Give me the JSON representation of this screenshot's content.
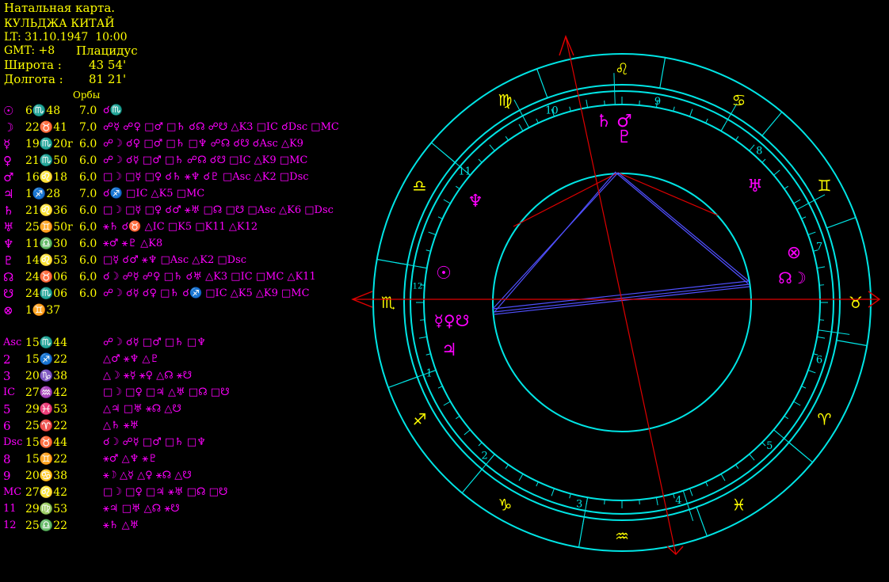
{
  "header": {
    "title": "Натальная карта.",
    "place": "КУЛЬДЖА КИТАЙ",
    "lt": "LT: 31.10.1947  10:00",
    "gmt": "GMT: +8",
    "house_system": "Плацидус",
    "lat_label": "Широта :",
    "lat_value": "43 54'",
    "lon_label": "Долгота :",
    "lon_value": "81 21'",
    "orbs_label": "Орбы"
  },
  "planets": [
    {
      "glyph": "☉",
      "pos": "6♏48",
      "orb": "7.0",
      "aspects": "☌♏"
    },
    {
      "glyph": "☽",
      "pos": "22♉41",
      "orb": "7.0",
      "aspects": "☍☿ ☍♀ □♂ □♄ ☌☊ ☍☋  △K3 □IC ☌Dsc □MC"
    },
    {
      "glyph": "☿",
      "pos": "19♏20r",
      "orb": "6.0",
      "aspects": "☍☽ ☌♀ □♂ □♄ □♆ ☍☊ ☌☋  ☌Asc △K9"
    },
    {
      "glyph": "♀",
      "pos": "21♏50",
      "orb": "6.0",
      "aspects": "☍☽ ☌☿ □♂ □♄ ☍☊ ☌☋  □IC △K9 □MC"
    },
    {
      "glyph": "♂",
      "pos": "16♌18",
      "orb": "6.0",
      "aspects": "□☽ □☿ □♀ ☌♄ ⚹♆ ☌♇  □Asc △K2 □Dsc"
    },
    {
      "glyph": "♃",
      "pos": "1♐28",
      "orb": "7.0",
      "aspects": "☌♐ □IC △K5 □MC"
    },
    {
      "glyph": "♄",
      "pos": "21♌36",
      "orb": "6.0",
      "aspects": "□☽ □☿ □♀ ☌♂ ⚹♅ □☊ □☋  □Asc △K6 □Dsc"
    },
    {
      "glyph": "♅",
      "pos": "25♊50r",
      "orb": "6.0",
      "aspects": "⚹♄ ☌♉ △IC □K5 □K11  △K12"
    },
    {
      "glyph": "♆",
      "pos": "11♎30",
      "orb": "6.0",
      "aspects": "⚹♂ ⚹♇ △K8"
    },
    {
      "glyph": "♇",
      "pos": "14♌53",
      "orb": "6.0",
      "aspects": "□☿ ☌♂ ⚹♆ □Asc △K2 □Dsc"
    },
    {
      "glyph": "☊",
      "pos": "24♉06",
      "orb": "6.0",
      "aspects": "☌☽ ☍☿ ☍♀ □♄ ☌♅  △K3 □IC □MC  △K11"
    },
    {
      "glyph": "☋",
      "pos": "24♏06",
      "orb": "6.0",
      "aspects": "☍☽ ☌☿ ☌♀ □♄ ☌♐  □IC △K5 △K9 □MC"
    },
    {
      "glyph": "⊗",
      "pos": "1♊37",
      "orb": "",
      "aspects": ""
    }
  ],
  "houses": [
    {
      "glyph": "Asc",
      "pos": "15♏44",
      "aspects": "☍☽ ☌☿ □♂ □♄ □♆"
    },
    {
      "glyph": "2",
      "pos": "15♐22",
      "aspects": "△♂ ⚹♆ △♇"
    },
    {
      "glyph": "3",
      "pos": "20♑38",
      "aspects": "△☽ ⚹☿ ⚹♀ △☊ ⚹☋"
    },
    {
      "glyph": "IC",
      "pos": "27♒42",
      "aspects": "□☽ □♀ □♃ △♅ □☊ □☋"
    },
    {
      "glyph": "5",
      "pos": "29♓53",
      "aspects": "△♃ □♅ ⚹☊ △☋"
    },
    {
      "glyph": "6",
      "pos": "25♈22",
      "aspects": "△♄ ⚹♅"
    },
    {
      "glyph": "Dsc",
      "pos": "15♉44",
      "aspects": "☌☽ ☍☿ □♂ □♄ □♆"
    },
    {
      "glyph": "8",
      "pos": "15♊22",
      "aspects": "⚹♂ △♆ ⚹♇"
    },
    {
      "glyph": "9",
      "pos": "20♋38",
      "aspects": "⚹☽ △☿ △♀ ⚹☊ △☋"
    },
    {
      "glyph": "MC",
      "pos": "27♌42",
      "aspects": "□☽ □♀ □♃ ⚹♅ □☊ □☋"
    },
    {
      "glyph": "11",
      "pos": "29♍53",
      "aspects": "⚹♃ □♅ △☊ ⚹☋"
    },
    {
      "glyph": "12",
      "pos": "25♎22",
      "aspects": "⚹♄ △♅"
    }
  ],
  "wheel": {
    "signs": [
      {
        "glyph": "♌"
      },
      {
        "glyph": "♋"
      },
      {
        "glyph": "♊"
      },
      {
        "glyph": "♉"
      },
      {
        "glyph": "♈"
      },
      {
        "glyph": "♓"
      },
      {
        "glyph": "♒"
      },
      {
        "glyph": "♑"
      },
      {
        "glyph": "♐"
      },
      {
        "glyph": "♏"
      },
      {
        "glyph": "♎"
      },
      {
        "glyph": "♍"
      }
    ],
    "house_numbers": [
      "9",
      "8",
      "7",
      "6",
      "5",
      "4",
      "3",
      "2",
      "1",
      "12",
      "11",
      "10"
    ],
    "planet_glyphs": [
      {
        "glyph": "♄"
      },
      {
        "glyph": "♂"
      },
      {
        "glyph": "♇"
      },
      {
        "glyph": "♅"
      },
      {
        "glyph": "⊗"
      },
      {
        "glyph": "☊☽"
      },
      {
        "glyph": "♆"
      },
      {
        "glyph": "☉"
      },
      {
        "glyph": "☿♀☋"
      },
      {
        "glyph": "♃"
      }
    ]
  },
  "colors": {
    "ring": "#00e5e5",
    "aspect_red": "#e00000",
    "aspect_blue": "#5050ff",
    "glyph": "#ff00ff",
    "text": "#ffff00"
  }
}
